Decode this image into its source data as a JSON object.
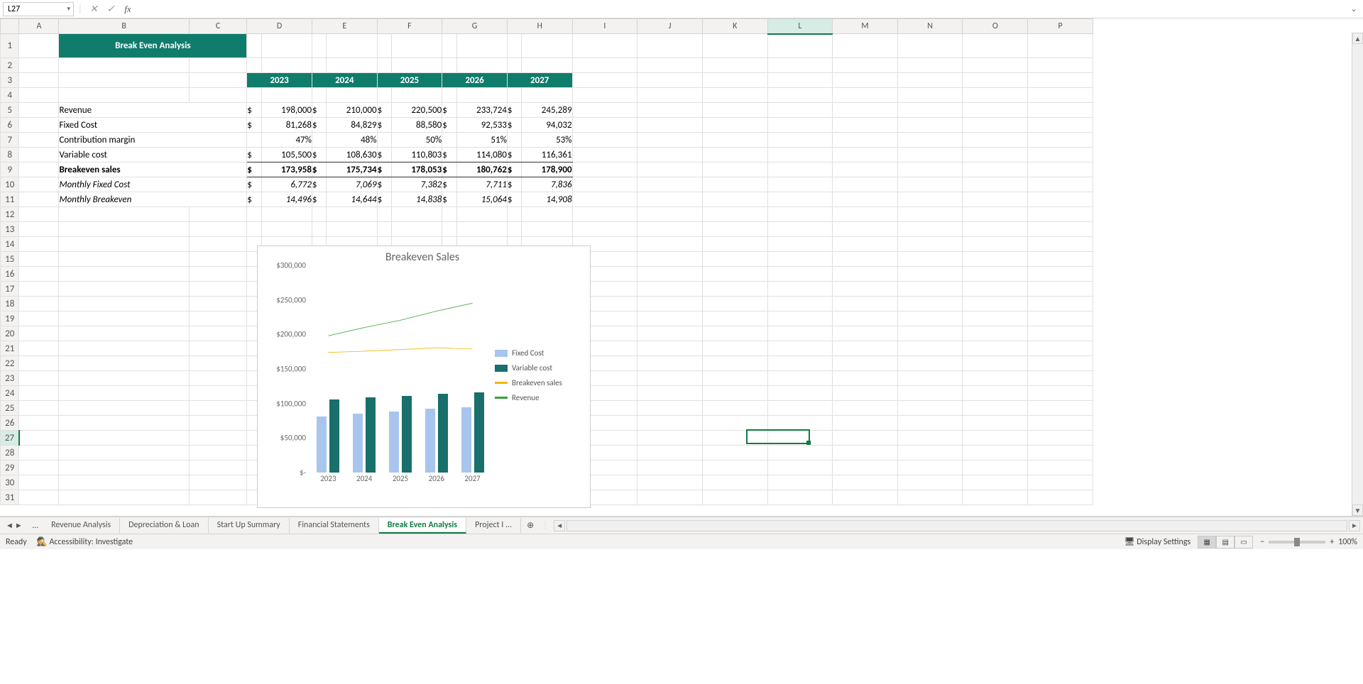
{
  "namebox": "L27",
  "formula": "",
  "title": "Break Even Analysis",
  "cols": [
    "A",
    "B",
    "C",
    "D",
    "E",
    "F",
    "G",
    "H",
    "I",
    "J",
    "K",
    "L",
    "M",
    "N",
    "O",
    "P"
  ],
  "years": [
    "2023",
    "2024",
    "2025",
    "2026",
    "2027"
  ],
  "rows": {
    "revenue": {
      "label": "Revenue",
      "dollar": true,
      "vals": [
        "198,000",
        "210,000",
        "220,500",
        "233,724",
        "245,289"
      ]
    },
    "fixed": {
      "label": "Fixed Cost",
      "dollar": true,
      "vals": [
        "81,268",
        "84,829",
        "88,580",
        "92,533",
        "94,032"
      ]
    },
    "cm": {
      "label": "Contribution margin",
      "dollar": false,
      "vals": [
        "47%",
        "48%",
        "50%",
        "51%",
        "53%"
      ]
    },
    "var": {
      "label": "Variable cost",
      "dollar": true,
      "vals": [
        "105,500",
        "108,630",
        "110,803",
        "114,080",
        "116,361"
      ]
    },
    "be": {
      "label": "Breakeven sales",
      "dollar": true,
      "vals": [
        "173,958",
        "175,734",
        "178,053",
        "180,762",
        "178,900"
      ]
    },
    "mfc": {
      "label": "Monthly Fixed Cost",
      "dollar": true,
      "vals": [
        "6,772",
        "7,069",
        "7,382",
        "7,711",
        "7,836"
      ]
    },
    "mbe": {
      "label": "Monthly Breakeven",
      "dollar": true,
      "vals": [
        "14,496",
        "14,644",
        "14,838",
        "15,064",
        "14,908"
      ]
    }
  },
  "chart_data": {
    "type": "bar",
    "title": "Breakeven Sales",
    "categories": [
      "2023",
      "2024",
      "2025",
      "2026",
      "2027"
    ],
    "ylim": [
      0,
      300000
    ],
    "yticks": [
      "$-",
      "$50,000",
      "$100,000",
      "$150,000",
      "$200,000",
      "$250,000",
      "$300,000"
    ],
    "series": [
      {
        "name": "Fixed Cost",
        "type": "bar",
        "color": "#a8c5ed",
        "values": [
          81268,
          84829,
          88580,
          92533,
          94032
        ]
      },
      {
        "name": "Variable cost",
        "type": "bar",
        "color": "#186f6b",
        "values": [
          105500,
          108630,
          110803,
          114080,
          116361
        ]
      },
      {
        "name": "Breakeven sales",
        "type": "line",
        "color": "#f2b705",
        "values": [
          173958,
          175734,
          178053,
          180762,
          178900
        ]
      },
      {
        "name": "Revenue",
        "type": "line",
        "color": "#36a336",
        "values": [
          198000,
          210000,
          220500,
          233724,
          245289
        ]
      }
    ]
  },
  "tabs": [
    "Revenue Analysis",
    "Depreciation & Loan",
    "Start Up Summary",
    "Financial Statements",
    "Break Even Analysis",
    "Project I ..."
  ],
  "active_tab": "Break Even Analysis",
  "status": {
    "ready": "Ready",
    "acc": "Accessibility: Investigate",
    "disp": "Display Settings",
    "zoom": "100%"
  }
}
